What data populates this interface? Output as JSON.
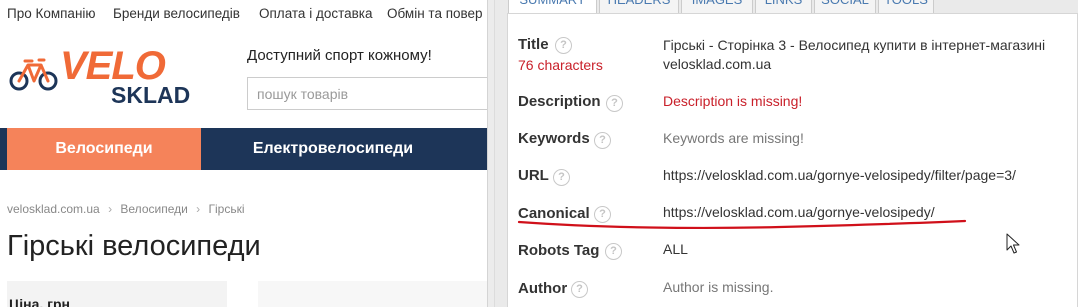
{
  "site": {
    "topnav": [
      "Про Компанію",
      "Бренди велосипедів",
      "Оплата і доставка",
      "Обмін та повер"
    ],
    "logo": {
      "velo": "VELO",
      "sklad": "SKLAD"
    },
    "slogan": "Доступний спорт кожному!",
    "search": {
      "placeholder": "пошук товарів"
    },
    "categories": [
      "Велосипеди",
      "Електровелосипеди"
    ],
    "breadcrumbs": [
      "velosklad.com.ua",
      "›",
      "Велосипеди",
      "›",
      "Гірські"
    ],
    "heading": "Гірські велосипеди",
    "filter_label": "Ціна, грн"
  },
  "panel": {
    "tabs": [
      "SUMMARY",
      "HEADERS",
      "IMAGES",
      "LINKS",
      "SOCIAL",
      "TOOLS"
    ],
    "rows": [
      {
        "label": "Title",
        "value_lines": [
          "Гірські - Сторінка 3 - Велосипед купити в інтернет-магазині",
          "velosklad.com.ua"
        ],
        "note": "76 characters"
      },
      {
        "label": "Description",
        "value": "Description is missing!"
      },
      {
        "label": "Keywords",
        "value": "Keywords are missing!"
      },
      {
        "label": "URL",
        "value": "https://velosklad.com.ua/gornye-velosipedy/filter/page=3/"
      },
      {
        "label": "Canonical",
        "value": "https://velosklad.com.ua/gornye-velosipedy/"
      },
      {
        "label": "Robots Tag",
        "value": "ALL"
      },
      {
        "label": "Author",
        "value": "Author is missing."
      }
    ],
    "help_glyph": "?"
  },
  "colors": {
    "brand_orange": "#f06a37",
    "brand_navy": "#1d3558",
    "error_red": "#c9202a",
    "annotation_red": "#d0101a",
    "tab_text": "#4a7ab0"
  },
  "icons": [
    "logo-bicycle-icon",
    "help-icon",
    "mouse-cursor-icon"
  ]
}
